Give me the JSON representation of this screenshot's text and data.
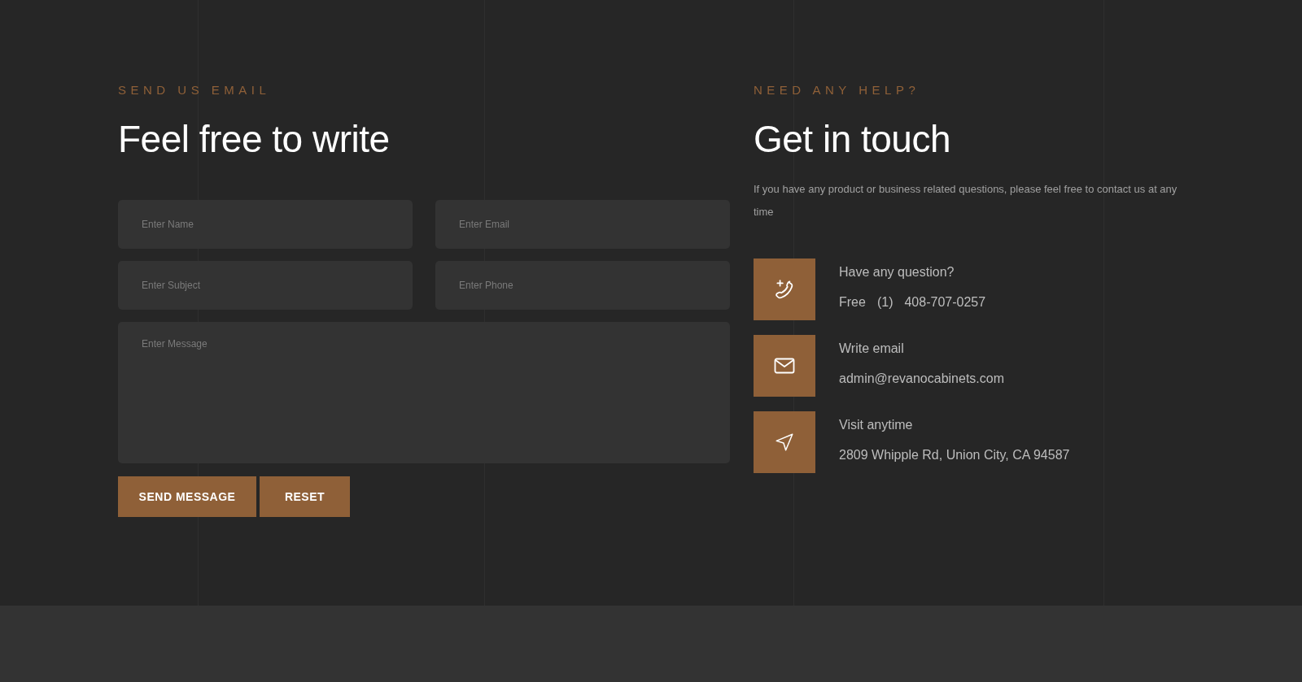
{
  "form_section": {
    "eyebrow": "SEND US EMAIL",
    "heading": "Feel free to write",
    "fields": [
      {
        "placeholder": "Enter Name"
      },
      {
        "placeholder": "Enter Email"
      },
      {
        "placeholder": "Enter Subject"
      },
      {
        "placeholder": "Enter Phone"
      }
    ],
    "message": {
      "placeholder": "Enter Message"
    },
    "buttons": [
      "SEND MESSAGE",
      "RESET"
    ]
  },
  "contact_section": {
    "eyebrow": "NEED ANY HELP?",
    "heading": "Get in touch",
    "description": "If you have any product or business related questions, please feel free to contact us at any time",
    "items": [
      {
        "kind": "phone",
        "title": "Have any question?",
        "value": [
          "Free",
          "(1)",
          "408-707-0257"
        ]
      },
      {
        "kind": "email",
        "title": "Write email",
        "value": [
          "admin@revanocabinets.com"
        ]
      },
      {
        "kind": "location",
        "title": "Visit anytime",
        "value": [
          "2809 Whipple Rd, Union City, CA 94587"
        ]
      }
    ]
  }
}
